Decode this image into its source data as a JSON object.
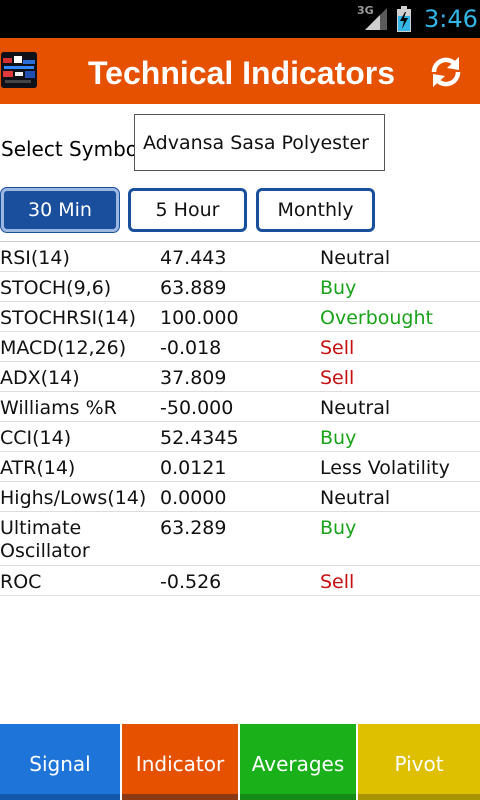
{
  "status_bar": {
    "network": "3G",
    "time": "3:46",
    "time_color": "#33b5e5"
  },
  "action_bar": {
    "title": "Technical Indicators",
    "color": "#e65100",
    "refresh_icon": "refresh-icon",
    "app_icon": "app-logo-icon"
  },
  "symbol": {
    "label": "Select Symbol",
    "value": "Advansa Sasa Polyester"
  },
  "timeframes": {
    "items": [
      {
        "label": "30 Min",
        "active": true
      },
      {
        "label": "5 Hour",
        "active": false
      },
      {
        "label": "Monthly",
        "active": false
      }
    ],
    "active_color": "#1a4f9e"
  },
  "indicators": [
    {
      "name": "RSI(14)",
      "value": "47.443",
      "action": "Neutral"
    },
    {
      "name": "STOCH(9,6)",
      "value": "63.889",
      "action": "Buy"
    },
    {
      "name": "STOCHRSI(14)",
      "value": "100.000",
      "action": "Overbought"
    },
    {
      "name": "MACD(12,26)",
      "value": "-0.018",
      "action": "Sell"
    },
    {
      "name": "ADX(14)",
      "value": "37.809",
      "action": "Sell"
    },
    {
      "name": "Williams %R",
      "value": "-50.000",
      "action": "Neutral"
    },
    {
      "name": "CCI(14)",
      "value": "52.4345",
      "action": "Buy"
    },
    {
      "name": "ATR(14)",
      "value": "0.0121",
      "action": "Less Volatility"
    },
    {
      "name": "Highs/Lows(14)",
      "value": "0.0000",
      "action": "Neutral"
    },
    {
      "name": "Ultimate Oscillator",
      "value": "63.289",
      "action": "Buy"
    },
    {
      "name": "ROC",
      "value": "-0.526",
      "action": "Sell"
    }
  ],
  "action_colors": {
    "buy": "#1aa31a",
    "sell": "#c41010",
    "neutral": "#111111"
  },
  "bottom_tabs": [
    {
      "label": "Signal",
      "color": "#1e74d8"
    },
    {
      "label": "Indicator",
      "color": "#e65100"
    },
    {
      "label": "Averages",
      "color": "#1ab01a"
    },
    {
      "label": "Pivot",
      "color": "#dfc000"
    }
  ]
}
